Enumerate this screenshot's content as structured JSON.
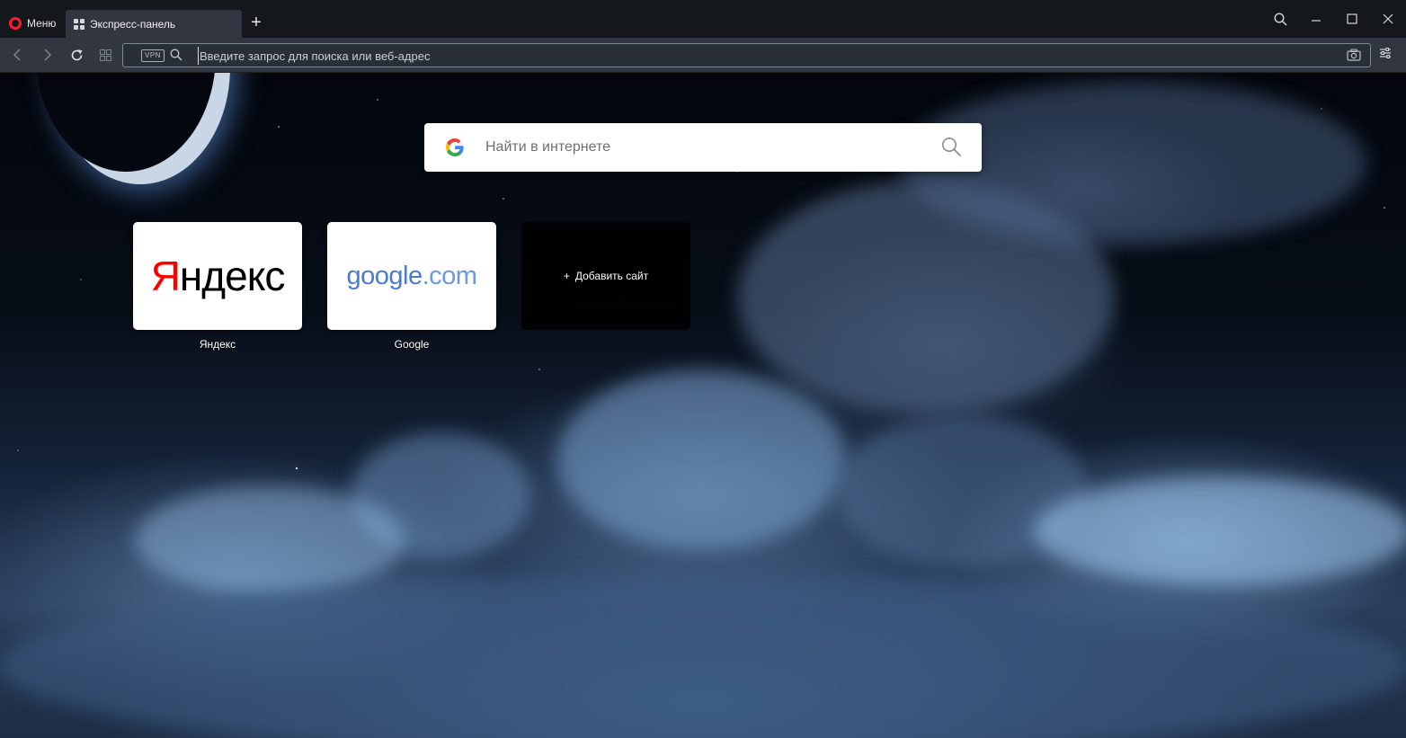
{
  "titlebar": {
    "menu_label": "Меню",
    "tab_label": "Экспресс-панель",
    "new_tab_symbol": "+"
  },
  "navbar": {
    "vpn_label": "VPN",
    "address_placeholder": "Введите запрос для поиска или веб-адрес"
  },
  "search": {
    "placeholder": "Найти в интернете"
  },
  "speed_dial": [
    {
      "logo_text_first": "Я",
      "logo_text_rest": "ндекс",
      "label": "Яндекс"
    },
    {
      "logo_text_main": "google",
      "logo_text_dom": ".com",
      "label": "Google"
    }
  ],
  "add_site": {
    "symbol": "+",
    "label": "Добавить сайт"
  },
  "colors": {
    "opera_red": "#ff1b2d",
    "tab_bg": "#313640",
    "titlebar_bg": "#14171c",
    "yandex_red": "#ff0000",
    "google_blue": "#4a7bd0"
  }
}
